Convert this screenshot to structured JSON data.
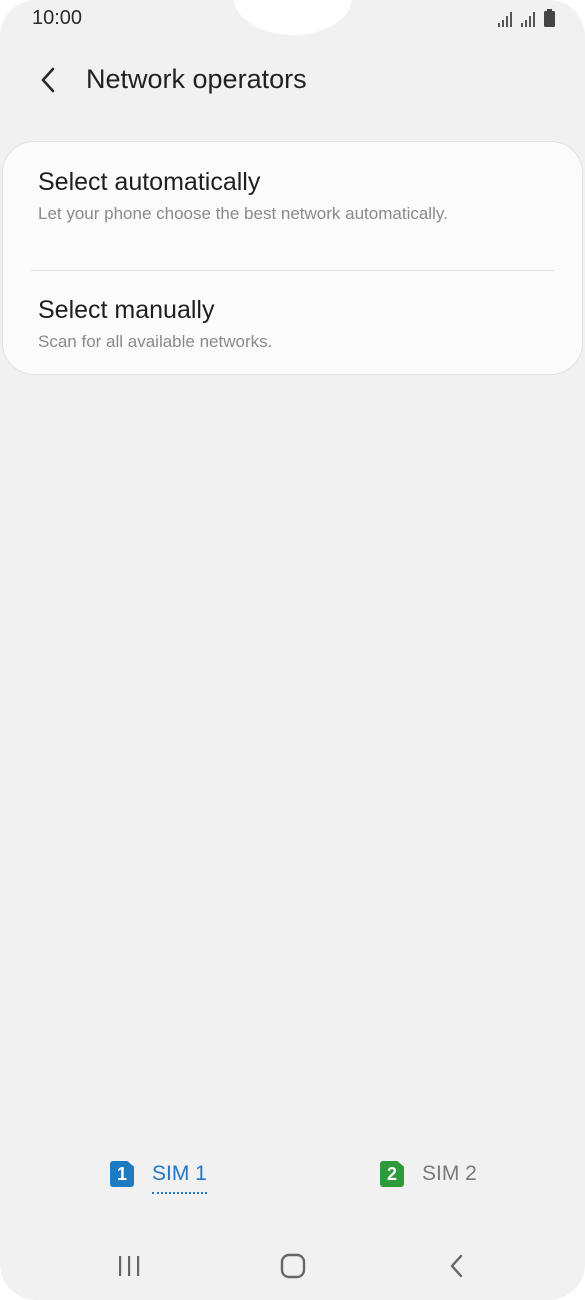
{
  "status_bar": {
    "time": "10:00",
    "icons": [
      "signal-sim1-icon",
      "signal-sim2-icon",
      "battery-icon"
    ]
  },
  "header": {
    "back_icon": "chevron-left-icon",
    "title": "Network operators"
  },
  "options": [
    {
      "title": "Select automatically",
      "subtitle": "Let your phone choose the best network automatically."
    },
    {
      "title": "Select manually",
      "subtitle": "Scan for all available networks."
    }
  ],
  "sim_tabs": [
    {
      "badge": "1",
      "label": "SIM 1",
      "selected": true,
      "color": "#1a7bc0"
    },
    {
      "badge": "2",
      "label": "SIM 2",
      "selected": false,
      "color": "#2e9b3a"
    }
  ],
  "nav_bar": {
    "icons": [
      "recent-apps-icon",
      "home-icon",
      "back-icon"
    ]
  },
  "colors": {
    "background": "#f1f1f1",
    "accent": "#2476c7"
  }
}
